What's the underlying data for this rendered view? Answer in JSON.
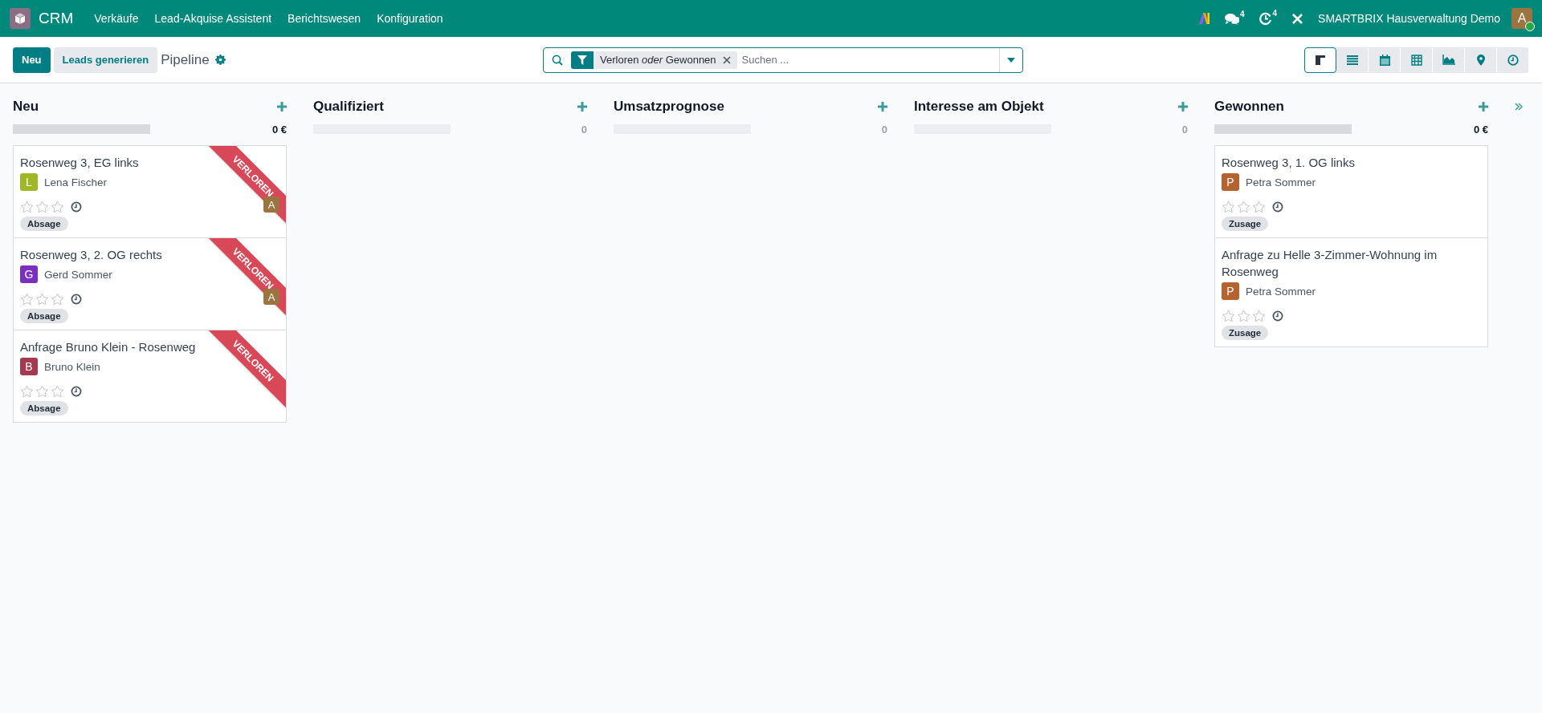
{
  "navbar": {
    "app_name": "CRM",
    "menu": [
      "Verkäufe",
      "Lead-Akquise Assistent",
      "Berichtswesen",
      "Konfiguration"
    ],
    "messages_badge": "4",
    "activities_badge": "4",
    "company": "SMARTBRIX Hausverwaltung Demo",
    "user_avatar": "A"
  },
  "control_panel": {
    "new_button": "Neu",
    "generate_button": "Leads generieren",
    "breadcrumb": "Pipeline",
    "search": {
      "facet": "Verloren *oder* Gewonnen",
      "placeholder": "Suchen ..."
    },
    "views": [
      {
        "kind": "kanban",
        "selected": true
      },
      {
        "kind": "list",
        "selected": false
      },
      {
        "kind": "calendar",
        "selected": false
      },
      {
        "kind": "pivot",
        "selected": false
      },
      {
        "kind": "graph",
        "selected": false
      },
      {
        "kind": "map",
        "selected": false
      },
      {
        "kind": "activity",
        "selected": false
      }
    ]
  },
  "columns": [
    {
      "title": "Neu",
      "total": "0 €",
      "level": 1,
      "cards": [
        {
          "title": "Rosenweg 3, EG links",
          "contact_initial": "L",
          "contact": "Lena Fischer",
          "color": "#a1b826",
          "stars": 0,
          "tag": "Absage",
          "ribbon": "VERLOREN",
          "assignee": "A"
        },
        {
          "title": "Rosenweg 3, 2. OG rechts",
          "contact_initial": "G",
          "contact": "Gerd Sommer",
          "color": "#7b2fbf",
          "stars": 0,
          "tag": "Absage",
          "ribbon": "VERLOREN",
          "assignee": "A"
        },
        {
          "title": "Anfrage Bruno Klein - Rosenweg",
          "contact_initial": "B",
          "contact": "Bruno Klein",
          "color": "#a5394f",
          "stars": 0,
          "tag": "Absage",
          "ribbon": "VERLOREN"
        }
      ]
    },
    {
      "title": "Qualifiziert",
      "total": "0",
      "level": 0
    },
    {
      "title": "Umsatzprognose",
      "total": "0",
      "level": 0
    },
    {
      "title": "Interesse am Objekt",
      "total": "0",
      "level": 0
    },
    {
      "title": "Gewonnen",
      "total": "0 €",
      "level": 1,
      "cards": [
        {
          "title": "Rosenweg 3, 1. OG links",
          "contact_initial": "P",
          "contact": "Petra Sommer",
          "color": "#b5632f",
          "stars": 0,
          "tag": "Zusage"
        },
        {
          "title": "Anfrage zu Helle 3-Zimmer-Wohnung im Rosenweg",
          "contact_initial": "P",
          "contact": "Petra Sommer",
          "color": "#b5632f",
          "stars": 0,
          "tag": "Zusage"
        }
      ]
    }
  ]
}
